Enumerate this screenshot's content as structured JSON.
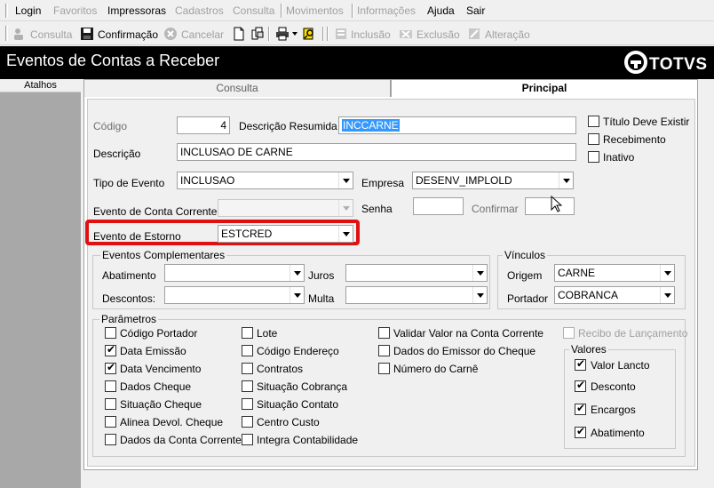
{
  "menu": {
    "login": "Login",
    "favoritos": "Favoritos",
    "impressoras": "Impressoras",
    "cadastros": "Cadastros",
    "consulta": "Consulta",
    "movimentos": "Movimentos",
    "informacoes": "Informações",
    "ajuda": "Ajuda",
    "sair": "Sair"
  },
  "toolbar": {
    "consulta": "Consulta",
    "confirmacao": "Confirmação",
    "cancelar": "Cancelar",
    "inclusao": "Inclusão",
    "exclusao": "Exclusão",
    "alteracao": "Alteração"
  },
  "window": {
    "title": "Eventos de Contas a Receber",
    "logo": "TOTVS"
  },
  "sidebar": {
    "header": "Atalhos"
  },
  "tabs": {
    "consulta": "Consulta",
    "principal": "Principal"
  },
  "form": {
    "codigo_label": "Código",
    "codigo_value": "4",
    "desc_resumida_label": "Descrição Resumida",
    "desc_resumida_value": "INCCARNE",
    "descricao_label": "Descrição",
    "descricao_value": "INCLUSAO DE CARNE",
    "tipo_evento_label": "Tipo de Evento",
    "tipo_evento_value": "INCLUSAO",
    "empresa_label": "Empresa",
    "empresa_value": "DESENV_IMPLOLD",
    "evento_cc_label": "Evento de Conta Corrente",
    "evento_cc_value": "",
    "senha_label": "Senha",
    "confirmar_label": "Confirmar",
    "evento_estorno_label": "Evento de Estorno",
    "evento_estorno_value": "ESTCRED",
    "titulo_deve_existir": "Título Deve Existir",
    "recebimento": "Recebimento",
    "inativo": "Inativo"
  },
  "complementares": {
    "title": "Eventos Complementares",
    "abatimento": "Abatimento",
    "juros": "Juros",
    "descontos": "Descontos:",
    "multa": "Multa"
  },
  "vinculos": {
    "title": "Vínculos",
    "origem_label": "Origem",
    "origem_value": "CARNE",
    "portador_label": "Portador",
    "portador_value": "COBRANCA"
  },
  "parametros": {
    "title": "Parâmetros",
    "col1": [
      "Código Portador",
      "Data Emissão",
      "Data Vencimento",
      "Dados Cheque",
      "Situação Cheque",
      "Alinea Devol. Cheque",
      "Dados da Conta Corrente"
    ],
    "col1_checked": [
      false,
      true,
      true,
      false,
      false,
      false,
      false
    ],
    "col2": [
      "Lote",
      "Código Endereço",
      "Contratos",
      "Situação Cobrança",
      "Situação Contato",
      "Centro Custo",
      "Integra Contabilidade"
    ],
    "col2_checked": [
      false,
      false,
      false,
      false,
      false,
      false,
      false
    ],
    "col3": [
      "Validar Valor na Conta Corrente",
      "Dados do Emissor do Cheque",
      "Número do Carnê"
    ],
    "col3_checked": [
      false,
      false,
      false
    ],
    "recibo": "Recibo de Lançamento",
    "valores_title": "Valores",
    "valores": [
      "Valor Lancto",
      "Desconto",
      "Encargos",
      "Abatimento"
    ],
    "valores_checked": [
      true,
      true,
      true,
      true
    ]
  }
}
